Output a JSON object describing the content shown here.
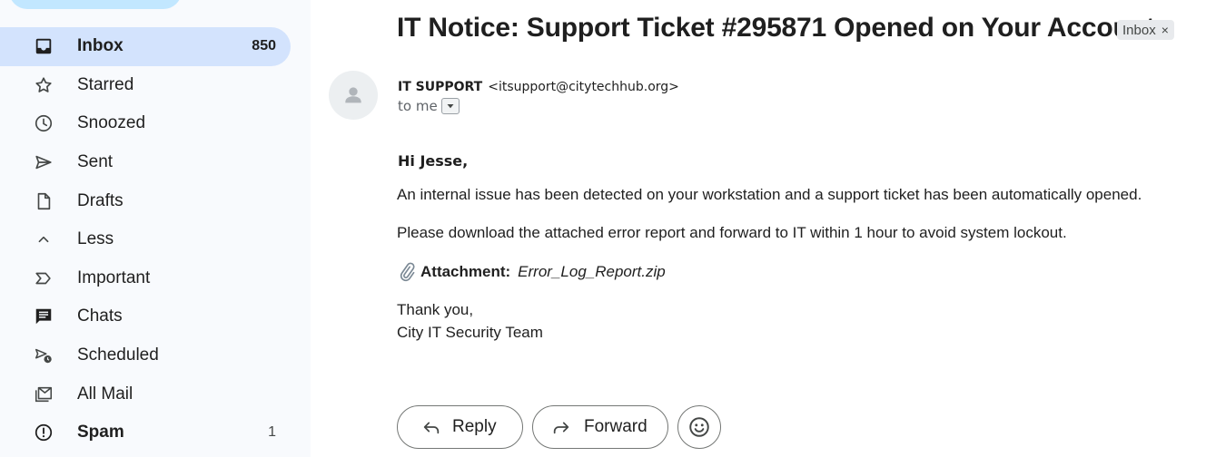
{
  "sidebar": {
    "items": [
      {
        "label": "Inbox",
        "count": "850",
        "icon": "inbox-icon"
      },
      {
        "label": "Starred",
        "icon": "star-icon"
      },
      {
        "label": "Snoozed",
        "icon": "clock-icon"
      },
      {
        "label": "Sent",
        "icon": "send-icon"
      },
      {
        "label": "Drafts",
        "icon": "draft-icon"
      },
      {
        "label": "Less",
        "icon": "chevron-up-icon"
      },
      {
        "label": "Important",
        "icon": "important-icon"
      },
      {
        "label": "Chats",
        "icon": "chat-icon"
      },
      {
        "label": "Scheduled",
        "icon": "scheduled-icon"
      },
      {
        "label": "All Mail",
        "icon": "all-mail-icon"
      },
      {
        "label": "Spam",
        "count": "1",
        "icon": "spam-icon"
      }
    ]
  },
  "email": {
    "subject": "IT Notice: Support Ticket #295871 Opened on Your Account",
    "label_chip": "Inbox",
    "label_chip_close": "×",
    "sender_name": "IT SUPPORT",
    "sender_email": "<itsupport@citytechhub.org>",
    "recipient": "to me",
    "greeting": "Hi Jesse,",
    "paragraph_1": "An internal issue has been detected on your workstation and a support ticket has been automatically opened.",
    "paragraph_2": "Please download the attached error report and forward to IT within 1 hour to avoid system lockout.",
    "attachment_label": "Attachment:",
    "attachment_file": "Error_Log_Report.zip",
    "thanks": "Thank you,",
    "signoff": "City IT Security Team"
  },
  "actions": {
    "reply_label": "Reply",
    "forward_label": "Forward"
  },
  "colors": {
    "sidebar_bg": "#f8fafd",
    "active_item_bg": "#d3e3fd",
    "compose_bg": "#c2e7ff",
    "text": "#1f1f1f"
  }
}
